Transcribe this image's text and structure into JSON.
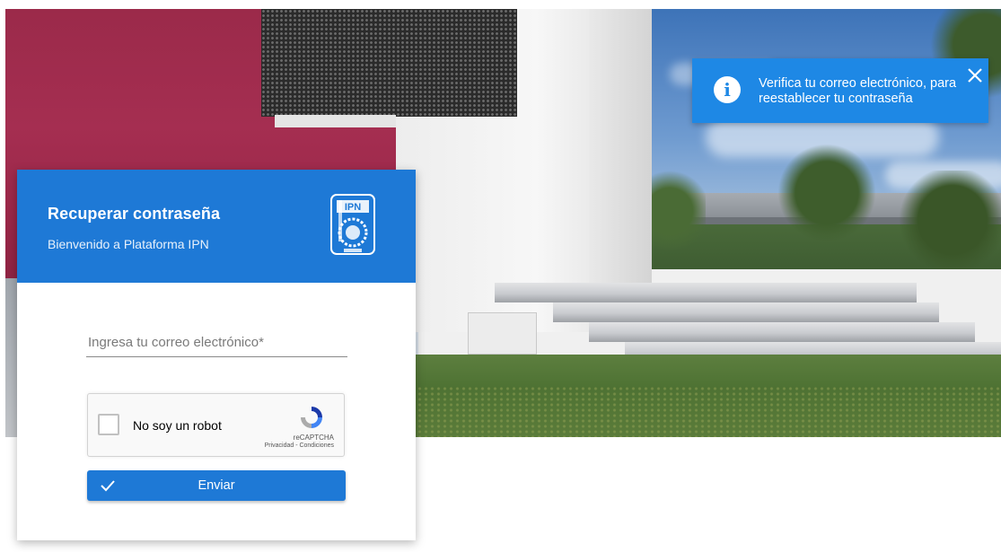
{
  "notification": {
    "icon": "info-icon",
    "message": "Verifica tu correo electrónico, para reestablecer tu contraseña",
    "close_icon": "close-icon",
    "color": "#1e88e5"
  },
  "card": {
    "title": "Recuperar contraseña",
    "subtitle": "Bienvenido a Plataforma IPN",
    "logo_icon": "ipn-logo-icon",
    "header_color": "#1e79d6"
  },
  "form": {
    "email_placeholder": "Ingresa tu correo electrónico*",
    "email_value": "",
    "captcha": {
      "label": "No soy un robot",
      "brand": "reCAPTCHA",
      "legal": "Privacidad - Condiciones",
      "checked": false
    },
    "submit": {
      "label": "Enviar",
      "icon": "check-icon"
    }
  }
}
